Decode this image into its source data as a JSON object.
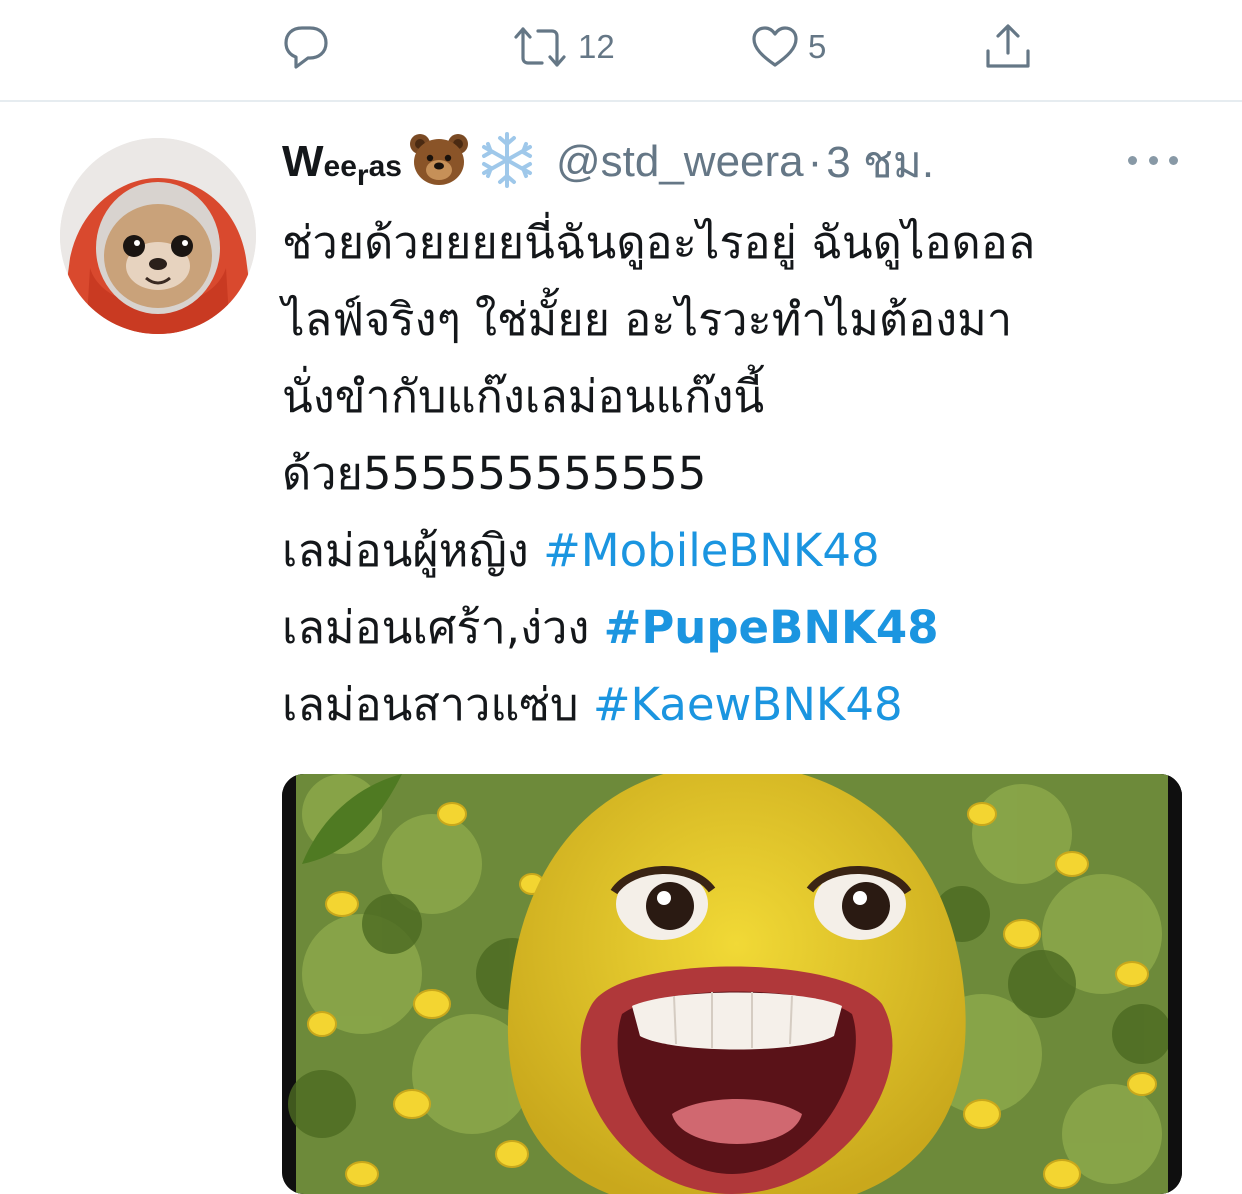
{
  "previous_tweet_actions": {
    "reply_count": "",
    "retweet_count": "12",
    "like_count": "5"
  },
  "tweet": {
    "display_name": "Weeras",
    "display_name_parts": [
      "W",
      "ee",
      "r",
      "as"
    ],
    "name_emojis": [
      "bear-icon",
      "snowflake-icon"
    ],
    "handle": "@std_weera",
    "separator": "·",
    "time": "3 ชม.",
    "text_lines": [
      "ช่วยด้วยยยยนี่ฉันดูอะไรอยู่ ฉันดูไอดอล",
      "ไลฟ์จริงๆ ใช่มั้ยย อะไรวะทำไมต้องมา",
      "นั่งขำกับแก๊งเลม่อนแก๊งนี้",
      "ด้วย555555555555"
    ],
    "hashtag_lines": [
      {
        "prefix": "เลม่อนผู้หญิง ",
        "hashtag": "#MobileBNK48"
      },
      {
        "prefix": "เลม่อนเศร้า,ง่วง ",
        "hashtag": "#PupeBNK48"
      },
      {
        "prefix": "เลม่อนสาวแซ่บ ",
        "hashtag": "#KaewBNK48"
      }
    ]
  },
  "colors": {
    "link": "#1b95e0",
    "secondary_text": "#657786",
    "divider": "#e6ecf0"
  }
}
